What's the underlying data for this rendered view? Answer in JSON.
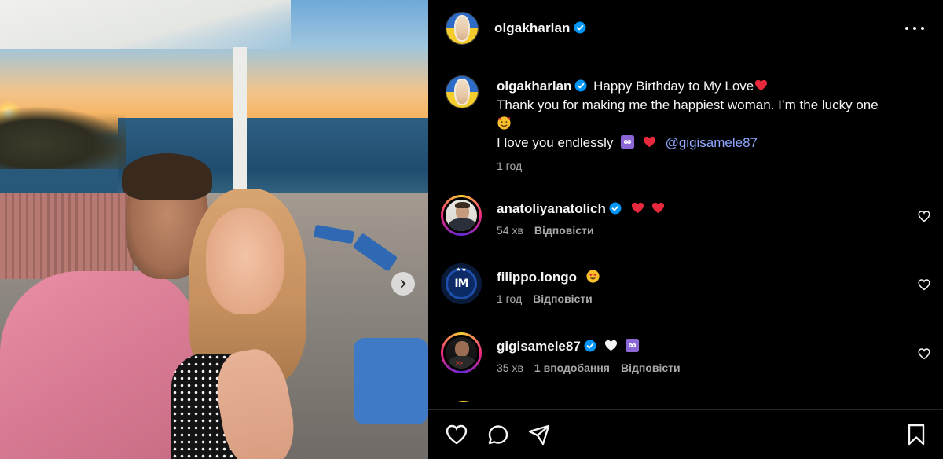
{
  "post": {
    "author": "olgakharlan",
    "caption_line1": "Happy Birthday to My Love",
    "caption_line2": "Thank you for making me the happiest woman. I’m the lucky one",
    "caption_line3_text": "I love you endlessly",
    "mention": "@gigisamele87",
    "time": "1 год"
  },
  "header": {
    "username": "olgakharlan"
  },
  "comments": [
    {
      "username": "anatoliyanatolich",
      "verified": true,
      "time": "54 хв",
      "reply_label": "Відповісти",
      "likes": ""
    },
    {
      "username": "filippo.longo",
      "verified": false,
      "time": "1 год",
      "reply_label": "Відповісти",
      "likes": ""
    },
    {
      "username": "gigisamele87",
      "verified": true,
      "time": "35 хв",
      "likes": "1 вподобання",
      "reply_label": "Відповісти"
    }
  ],
  "icons": {
    "header_more": "more-horizontal-icon",
    "verified": "verified-badge-icon",
    "like": "heart-icon",
    "comment": "comment-icon",
    "share": "paper-plane-icon",
    "save": "bookmark-icon",
    "carousel": "chevron-right-icon"
  },
  "colors": {
    "background": "#000000",
    "text": "#f5f5f5",
    "secondary_text": "#a8a8a8",
    "verified_blue": "#0095f6",
    "mention": "#8ea7ff",
    "divider": "#262626"
  }
}
